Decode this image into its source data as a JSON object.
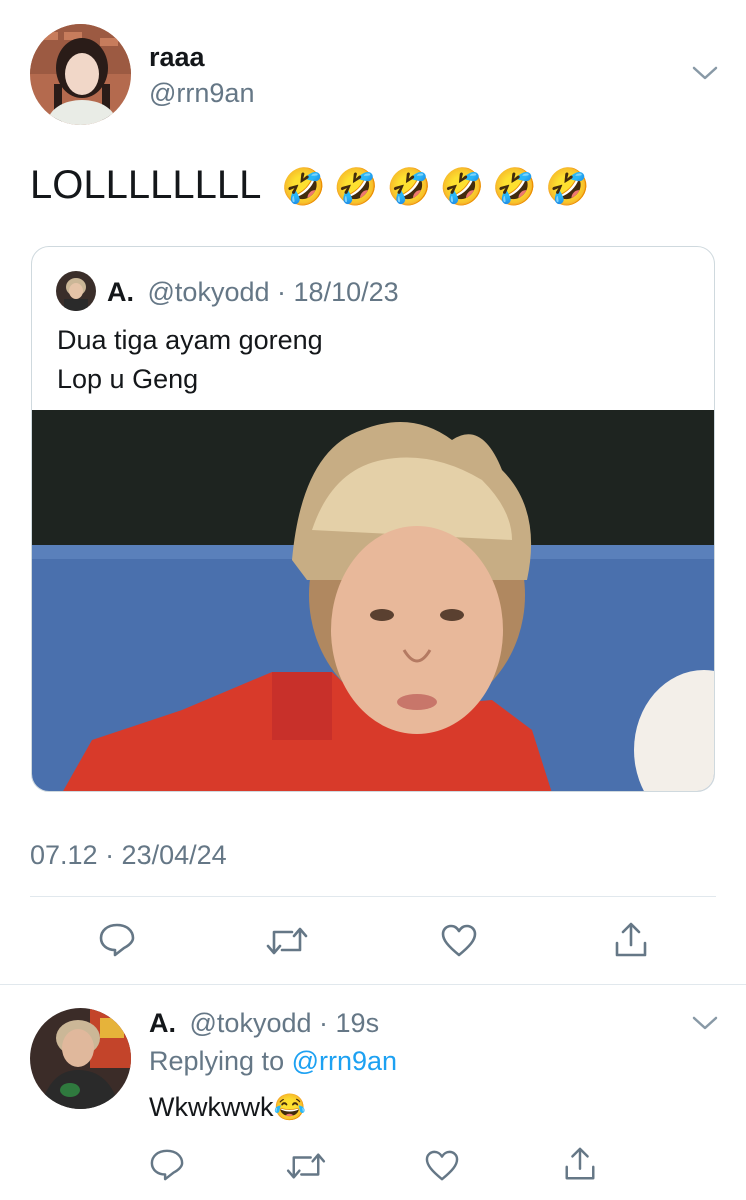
{
  "tweet": {
    "display_name": "raaa",
    "handle": "@rrn9an",
    "text": "LOLLLLLLLL",
    "emoji": [
      "🤣",
      "🤣",
      "🤣",
      "🤣",
      "🤣",
      "🤣"
    ],
    "timestamp": "07.12 · 23/04/24"
  },
  "quoted": {
    "display_name": "A.",
    "handle": "@tokyodd",
    "sep": "·",
    "date": "18/10/23",
    "line1": "Dua tiga ayam goreng",
    "line2": "Lop u Geng"
  },
  "reply": {
    "display_name": "A.",
    "handle": "@tokyodd",
    "sep": "·",
    "time": "19s",
    "replying_prefix": "Replying to",
    "replying_to": "@rrn9an",
    "text": "Wkwkwwk",
    "emoji": "😂"
  },
  "actions": [
    "comment-icon",
    "retweet-icon",
    "like-icon",
    "share-icon"
  ],
  "colors": {
    "link": "#1da1f2",
    "muted": "#657786",
    "icon": "#657786"
  }
}
